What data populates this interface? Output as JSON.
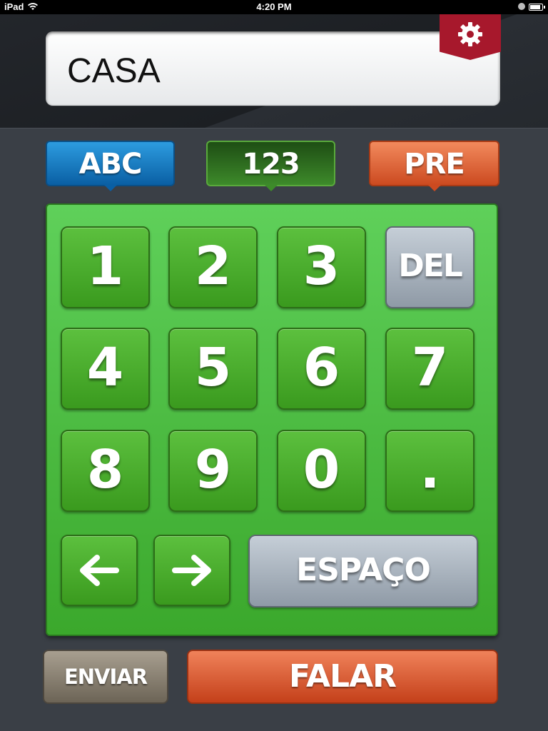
{
  "status_bar": {
    "device": "iPad",
    "time": "4:20 PM",
    "battery_level": 0.95
  },
  "display": {
    "text": "CASA"
  },
  "settings": {
    "icon": "gear-icon"
  },
  "modes": {
    "abc": "ABC",
    "numbers": "123",
    "pre": "PRE",
    "active": "123"
  },
  "keypad": {
    "keys": [
      "1",
      "2",
      "3",
      "4",
      "5",
      "6",
      "7",
      "8",
      "9",
      "0",
      "."
    ],
    "delete": "DEL",
    "left_icon": "arrow-left-icon",
    "right_icon": "arrow-right-icon",
    "space": "ESPAÇO"
  },
  "actions": {
    "send": "ENVIAR",
    "speak": "FALAR"
  },
  "colors": {
    "abc": "#1a7cc4",
    "numbers": "#3d8a2a",
    "pre": "#e0683a",
    "keypad": "#4fbf44",
    "settings": "#a7182c"
  }
}
